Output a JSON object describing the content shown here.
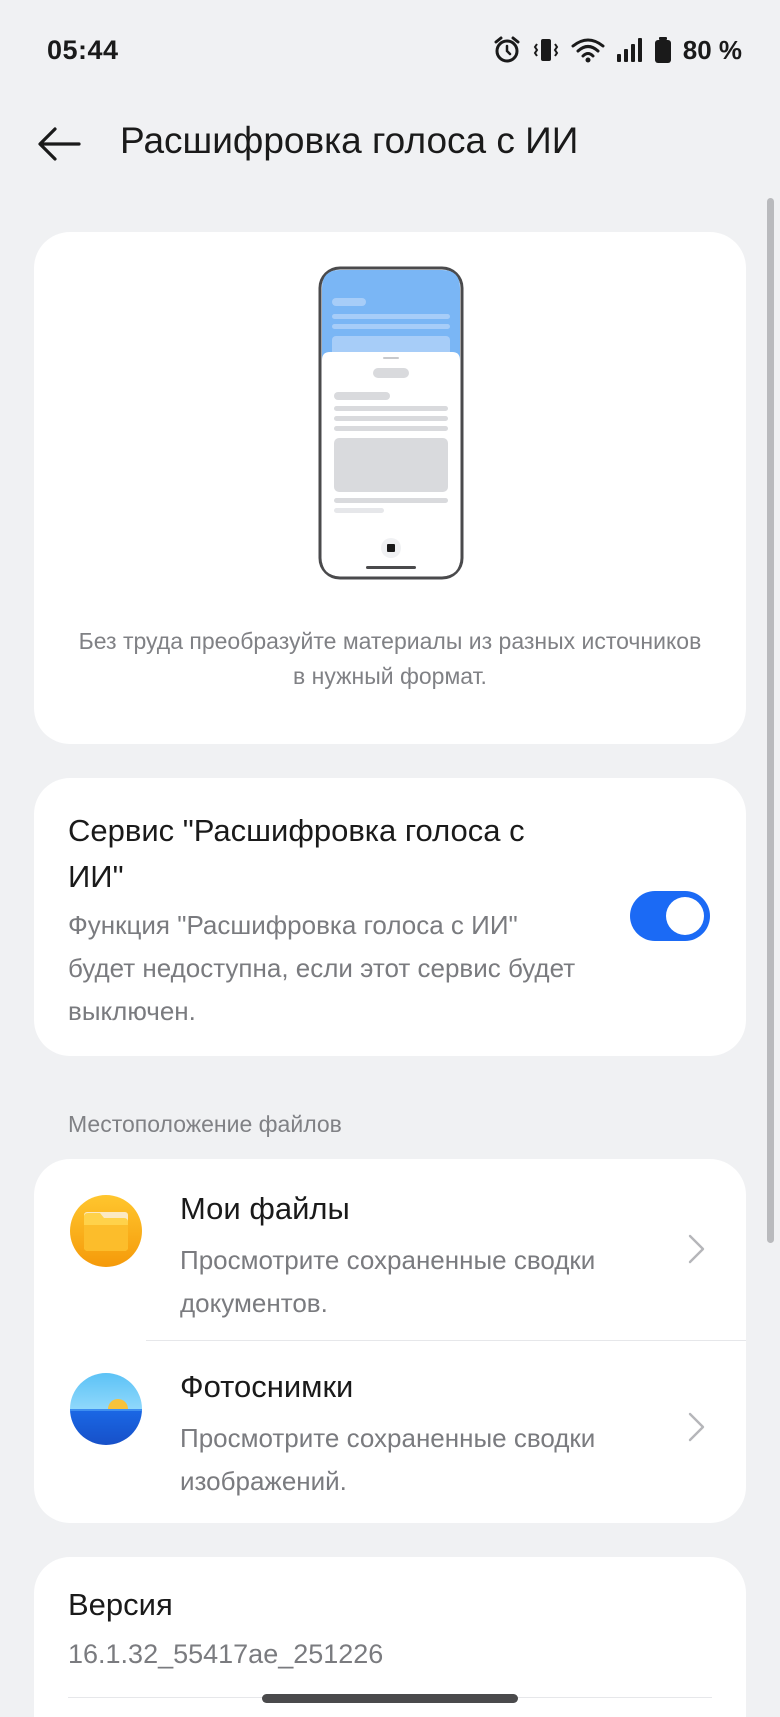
{
  "status_bar": {
    "time": "05:44",
    "battery_text": "80 %",
    "icons": [
      "alarm-icon",
      "vibrate-icon",
      "wifi-icon",
      "signal-icon",
      "battery-icon"
    ]
  },
  "header": {
    "title": "Расшифровка голоса с ИИ",
    "back_icon": "arrow-left-icon"
  },
  "illustration": {
    "caption": "Без труда преобразуйте материалы из разных источников в нужный формат."
  },
  "service": {
    "title": "Сервис \"Расшифровка голоса с ИИ\"",
    "description": "Функция \"Расшифровка голоса с ИИ\" будет недоступна, если этот сервис будет выключен.",
    "enabled": true
  },
  "files_section": {
    "label": "Местоположение файлов",
    "items": [
      {
        "title": "Мои файлы",
        "description": "Просмотрите сохраненные сводки документов.",
        "icon": "folder-icon"
      },
      {
        "title": "Фотоснимки",
        "description": "Просмотрите сохраненные сводки изображений.",
        "icon": "photos-icon"
      }
    ]
  },
  "version": {
    "title": "Версия",
    "value": "16.1.32_55417ae_251226"
  },
  "colors": {
    "accent": "#1b6af5",
    "background": "#f0f1f3",
    "card": "#ffffff",
    "secondary_text": "#7a7b7f"
  }
}
